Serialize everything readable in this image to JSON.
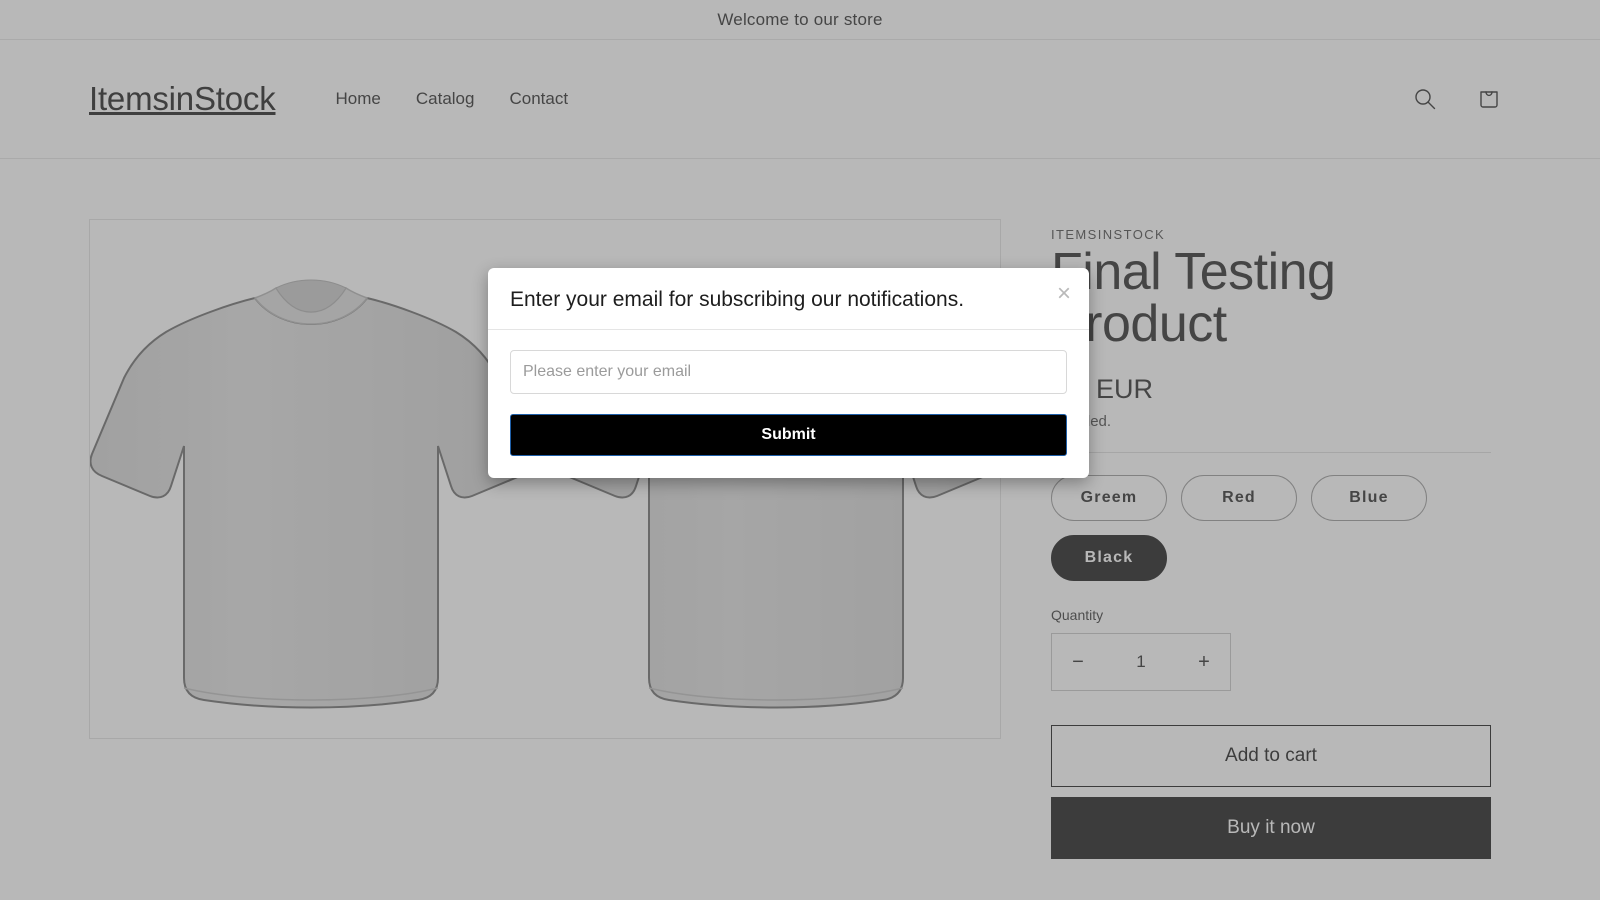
{
  "announcement": {
    "text": "Welcome to our store"
  },
  "header": {
    "brand": "ItemsinStock",
    "nav": [
      {
        "label": "Home"
      },
      {
        "label": "Catalog"
      },
      {
        "label": "Contact"
      }
    ],
    "search_icon": "search-icon",
    "cart_icon": "cart-icon"
  },
  "product": {
    "vendor": "ITEMSINSTOCK",
    "title": "Final Testing Product",
    "price": ",00 EUR",
    "tax_note": "included.",
    "variant_label": "",
    "variants": [
      {
        "label": "Greem",
        "selected": false
      },
      {
        "label": "Red",
        "selected": false
      },
      {
        "label": "Blue",
        "selected": false
      },
      {
        "label": "Black",
        "selected": true
      }
    ],
    "quantity": {
      "label": "Quantity",
      "decrease": "−",
      "value": "1",
      "increase": "+"
    },
    "add_to_cart_label": "Add to cart",
    "buy_now_label": "Buy it now"
  },
  "modal": {
    "title": "Enter your email for subscribing our notifications.",
    "close_label": "×",
    "email_placeholder": "Please enter your email",
    "email_value": "",
    "submit_label": "Submit"
  },
  "colors": {
    "accent": "#000000",
    "overlay": "#646464",
    "selected_pill": "#1b1b1b",
    "focus_ring": "#1f5fa8"
  }
}
